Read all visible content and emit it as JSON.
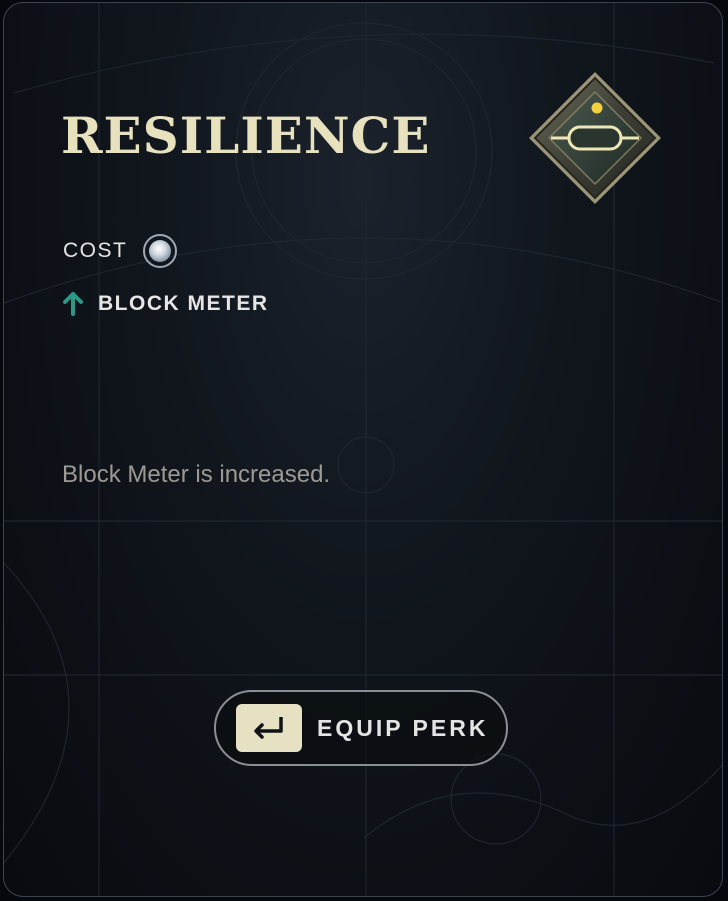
{
  "perk": {
    "title": "RESILIENCE",
    "cost_label": "COST",
    "cost_icon": "silver-orb-icon",
    "stat_icon": "arrow-up-icon",
    "stat_label": "BLOCK METER",
    "description": "Block Meter is increased.",
    "perk_icon": "resilience-diamond-icon"
  },
  "actions": {
    "equip_label": "EQUIP PERK",
    "equip_key_icon": "enter-key-icon"
  },
  "colors": {
    "title": "#e7e1bd",
    "stat_arrow": "#2a9a86",
    "key_badge": "#e6e1c2",
    "description": "#9d9a93"
  }
}
